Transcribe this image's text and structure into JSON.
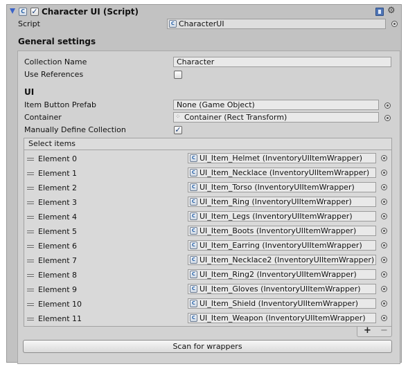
{
  "component": {
    "title": "Character UI (Script)",
    "enabled": true,
    "script_label": "Script",
    "script_value": "CharacterUI",
    "icons": {
      "fold": "triangle-down-icon",
      "script": "cs-script-icon",
      "help": "book-help-icon",
      "settings": "gear-icon"
    },
    "accent": "#3a63c9"
  },
  "general": {
    "title": "General settings",
    "collection_name_label": "Collection Name",
    "collection_name_value": "Character",
    "use_references_label": "Use References",
    "use_references": false
  },
  "ui": {
    "title": "UI",
    "item_button_prefab_label": "Item Button Prefab",
    "item_button_prefab_value": "None (Game Object)",
    "container_label": "Container",
    "container_value": "Container (Rect Transform)",
    "manually_define_label": "Manually Define Collection",
    "manually_define": true
  },
  "select_items": {
    "title": "Select items",
    "elements": [
      {
        "label": "Element 0",
        "value": "UI_Item_Helmet (InventoryUIItemWrapper)"
      },
      {
        "label": "Element 1",
        "value": "UI_Item_Necklace (InventoryUIItemWrapper)"
      },
      {
        "label": "Element 2",
        "value": "UI_Item_Torso (InventoryUIItemWrapper)"
      },
      {
        "label": "Element 3",
        "value": "UI_Item_Ring (InventoryUIItemWrapper)"
      },
      {
        "label": "Element 4",
        "value": "UI_Item_Legs (InventoryUIItemWrapper)"
      },
      {
        "label": "Element 5",
        "value": "UI_Item_Boots (InventoryUIItemWrapper)"
      },
      {
        "label": "Element 6",
        "value": "UI_Item_Earring (InventoryUIItemWrapper)"
      },
      {
        "label": "Element 7",
        "value": "UI_Item_Necklace2 (InventoryUIItemWrapper)"
      },
      {
        "label": "Element 8",
        "value": "UI_Item_Ring2 (InventoryUIItemWrapper)"
      },
      {
        "label": "Element 9",
        "value": "UI_Item_Gloves (InventoryUIItemWrapper)"
      },
      {
        "label": "Element 10",
        "value": "UI_Item_Shield (InventoryUIItemWrapper)"
      },
      {
        "label": "Element 11",
        "value": "UI_Item_Weapon (InventoryUIItemWrapper)"
      }
    ],
    "add_label": "+",
    "remove_label": "−"
  },
  "scan_button_label": "Scan for wrappers"
}
